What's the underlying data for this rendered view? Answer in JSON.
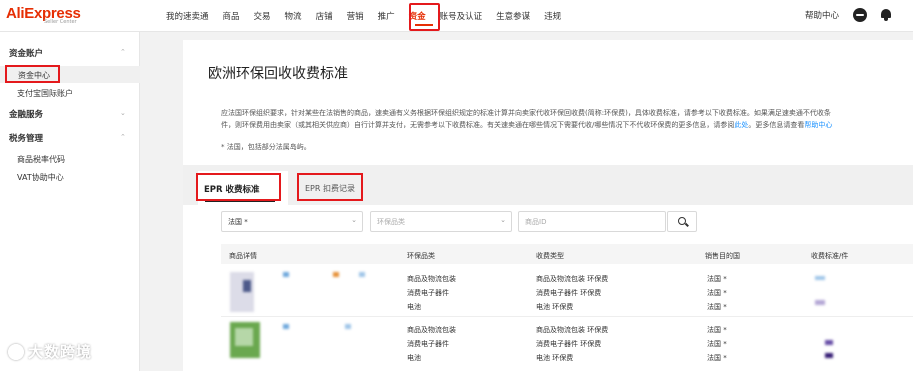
{
  "header": {
    "logo_main": "AliExpress",
    "logo_sub": "Seller Center",
    "nav": [
      "我的速卖通",
      "商品",
      "交易",
      "物流",
      "店铺",
      "营销",
      "推广",
      "资金",
      "账号及认证",
      "生意参谋",
      "违规"
    ],
    "active_nav": "资金",
    "help": "帮助中心"
  },
  "sidebar": {
    "sections": [
      {
        "title": "资金账户",
        "items": [
          "资金中心",
          "支付宝国际账户"
        ]
      },
      {
        "title": "金融服务",
        "items": []
      },
      {
        "title": "税务管理",
        "items": [
          "商品税率代码",
          "VAT协助中心"
        ]
      }
    ],
    "active_item": "资金中心"
  },
  "main": {
    "title": "欧洲环保回收收费标准",
    "desc_line1": "应法国环保组织要求，针对某些在法销售的商品，速卖通有义务根据环保组织规定的标准计算并向卖家代收环保回收费(简称:环保费)，具体收费标准，请参考以下收费标准。如果满足速卖通不代收条",
    "desc_line2a": "件，则环保费用由卖家（或其相关供应商）自行计算并支付，无需参考以下收费标准。有关速卖通在哪些情况下需要代收/哪些情况下不代收环保费的更多信息，请参阅",
    "desc_link1": "此处",
    "desc_line2b": "。更多信息请查看",
    "desc_link2": "帮助中心",
    "note": "* 法国，包括部分法属岛屿。",
    "tabs": [
      "EPR 收费标准",
      "EPR 扣费记录"
    ],
    "filters": {
      "country": "法国 *",
      "category_placeholder": "环保品类",
      "sku_placeholder": "商品ID"
    },
    "columns": [
      "商品详情",
      "环保品类",
      "收费类型",
      "销售目的国",
      "收费标准/件"
    ],
    "rows": [
      {
        "categories": [
          "商品及物流包装",
          "消费电子器件",
          "电池"
        ],
        "fee_types": [
          "商品及物流包装 环保费",
          "消费电子器件 环保费",
          "电池 环保费"
        ],
        "countries": [
          "法国 *",
          "法国 *",
          "法国 *"
        ]
      },
      {
        "categories": [
          "商品及物流包装",
          "消费电子器件",
          "电池"
        ],
        "fee_types": [
          "商品及物流包装 环保费",
          "消费电子器件 环保费",
          "电池 环保费"
        ],
        "countries": [
          "法国 *",
          "法国 *",
          "法国 *"
        ]
      }
    ]
  },
  "watermark": "大数跨境",
  "colors": {
    "brand": "#e62e04",
    "highlight": "#e4191c",
    "link": "#1890ff"
  }
}
